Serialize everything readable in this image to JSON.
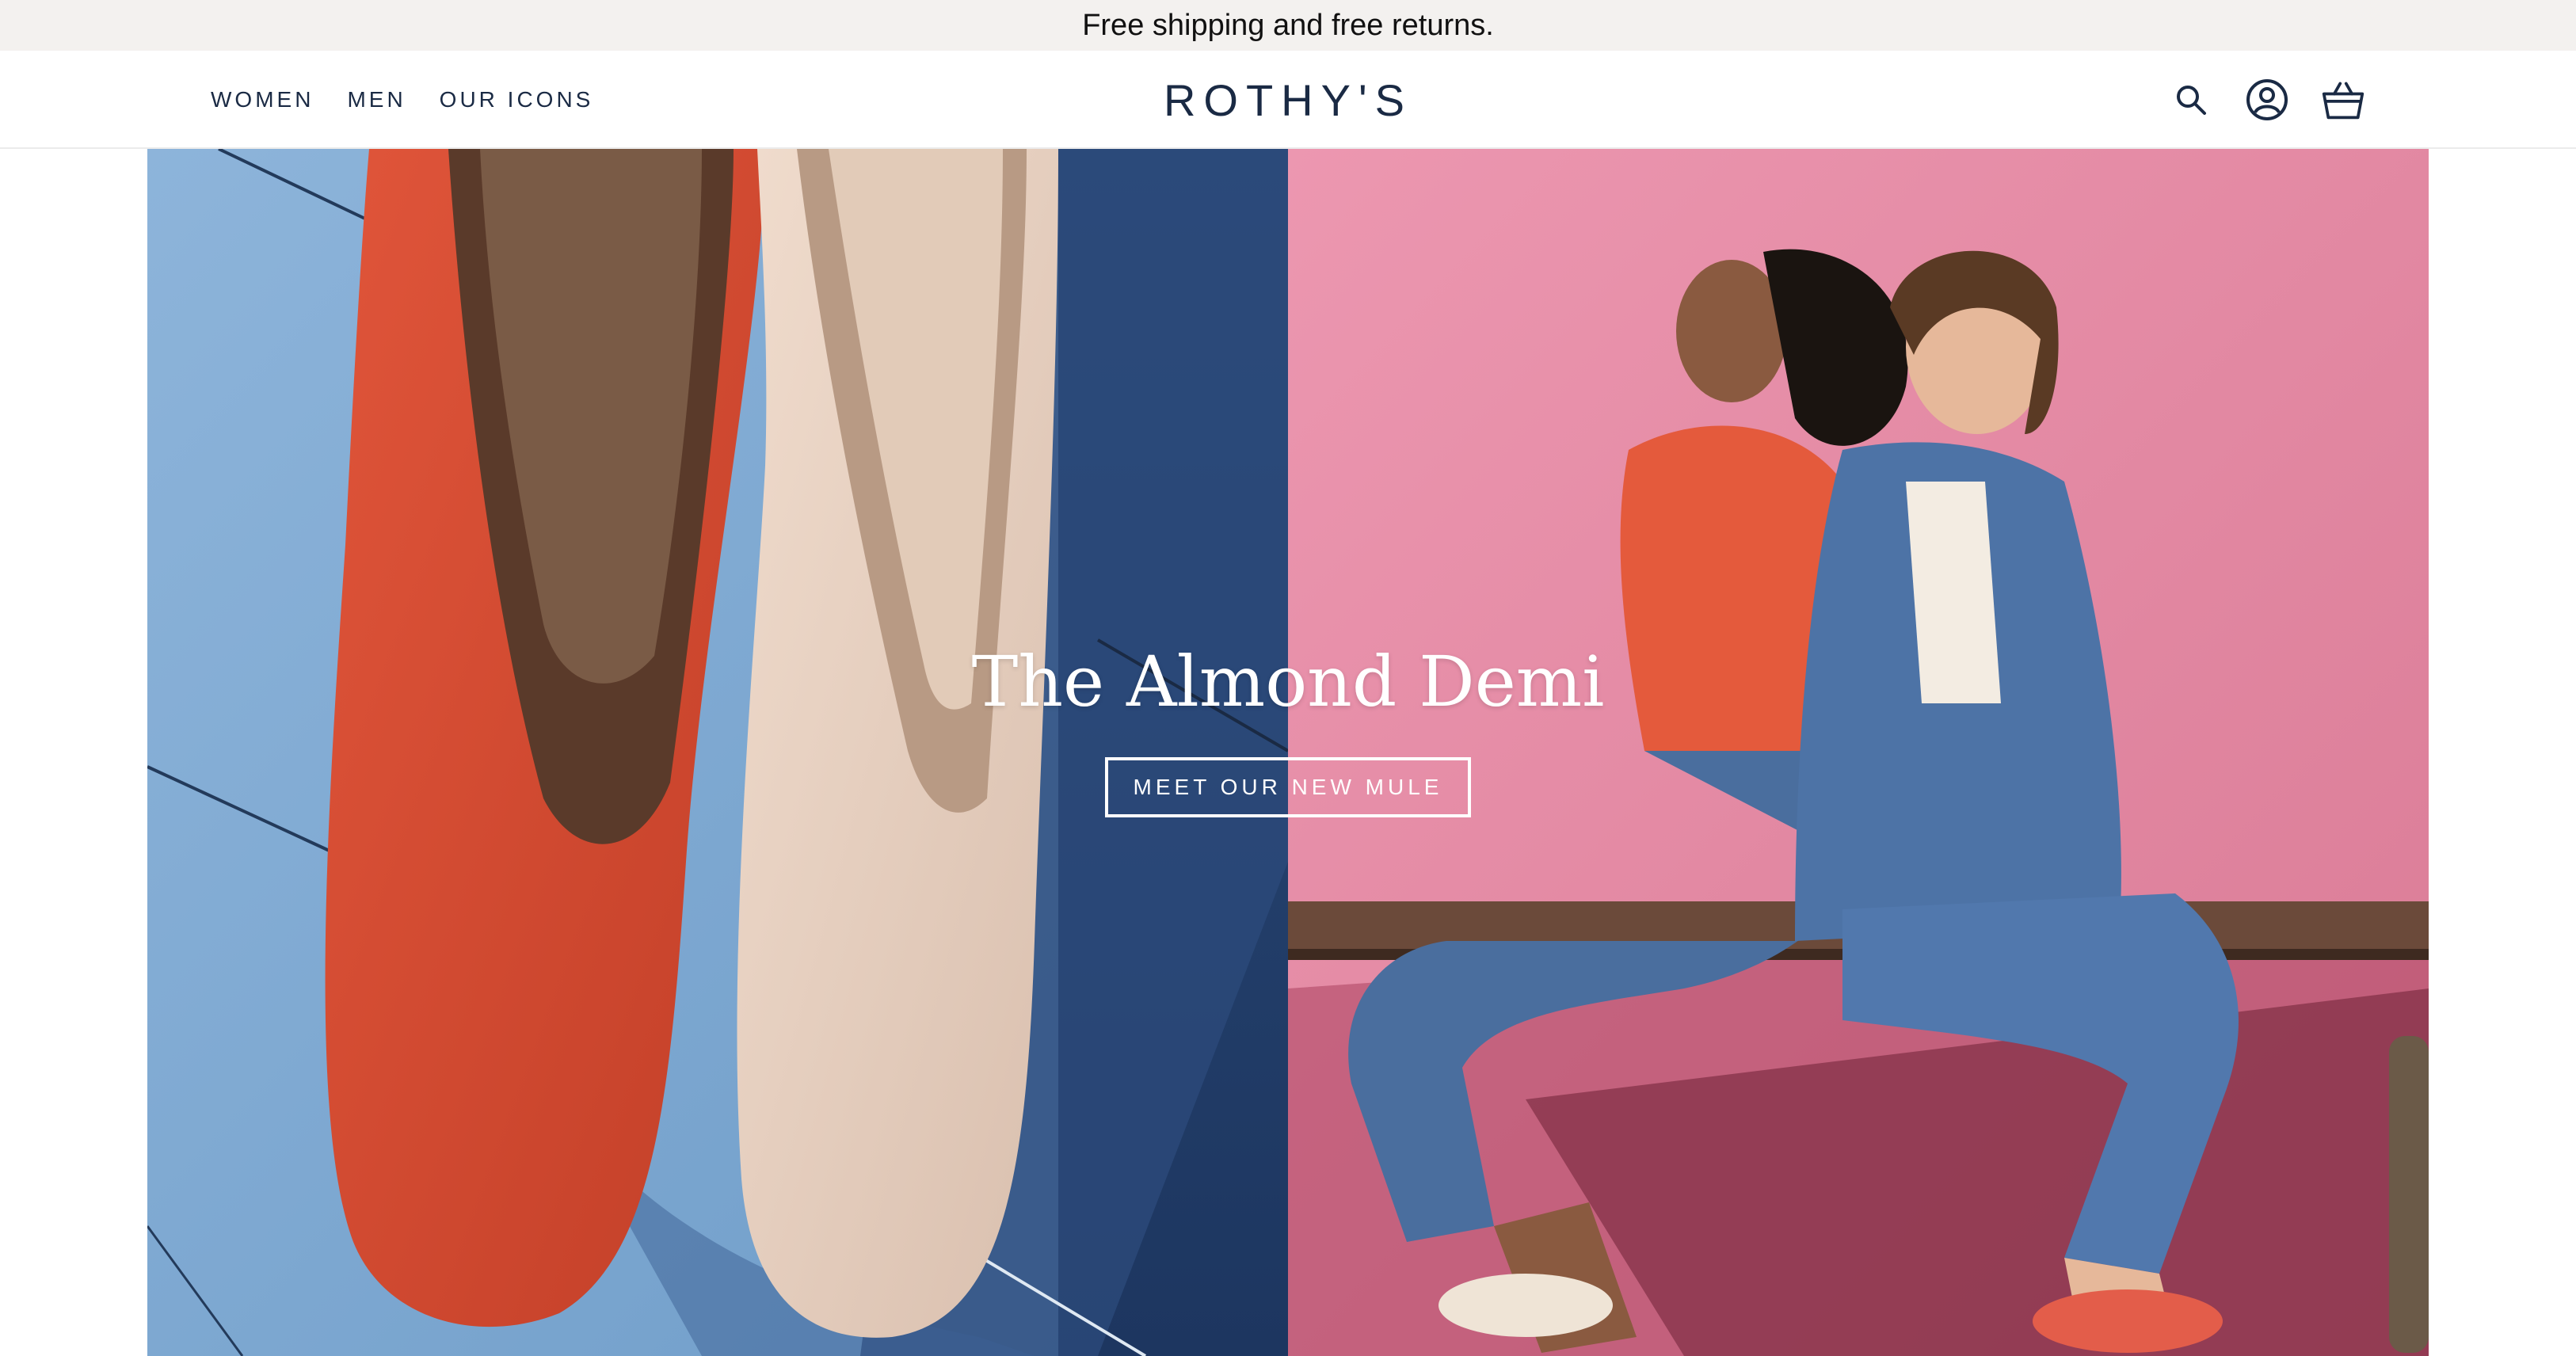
{
  "announcement": "Free shipping and free returns.",
  "nav": {
    "items": [
      {
        "label": "WOMEN"
      },
      {
        "label": "MEN"
      },
      {
        "label": "OUR ICONS"
      }
    ]
  },
  "brand": {
    "logo": "ROTHY'S"
  },
  "header_icons": [
    "search-icon",
    "account-icon",
    "cart-icon"
  ],
  "hero": {
    "title": "The Almond Demi",
    "cta_label": "MEET OUR NEW MULE"
  },
  "colors": {
    "navy": "#1a2a44",
    "shoe_red": "#d84a30",
    "shoe_blush": "#e8d2c2",
    "wall_pink": "#e48aa2",
    "denim": "#4a6e9e",
    "tile_blue": "#7ea8d2"
  }
}
